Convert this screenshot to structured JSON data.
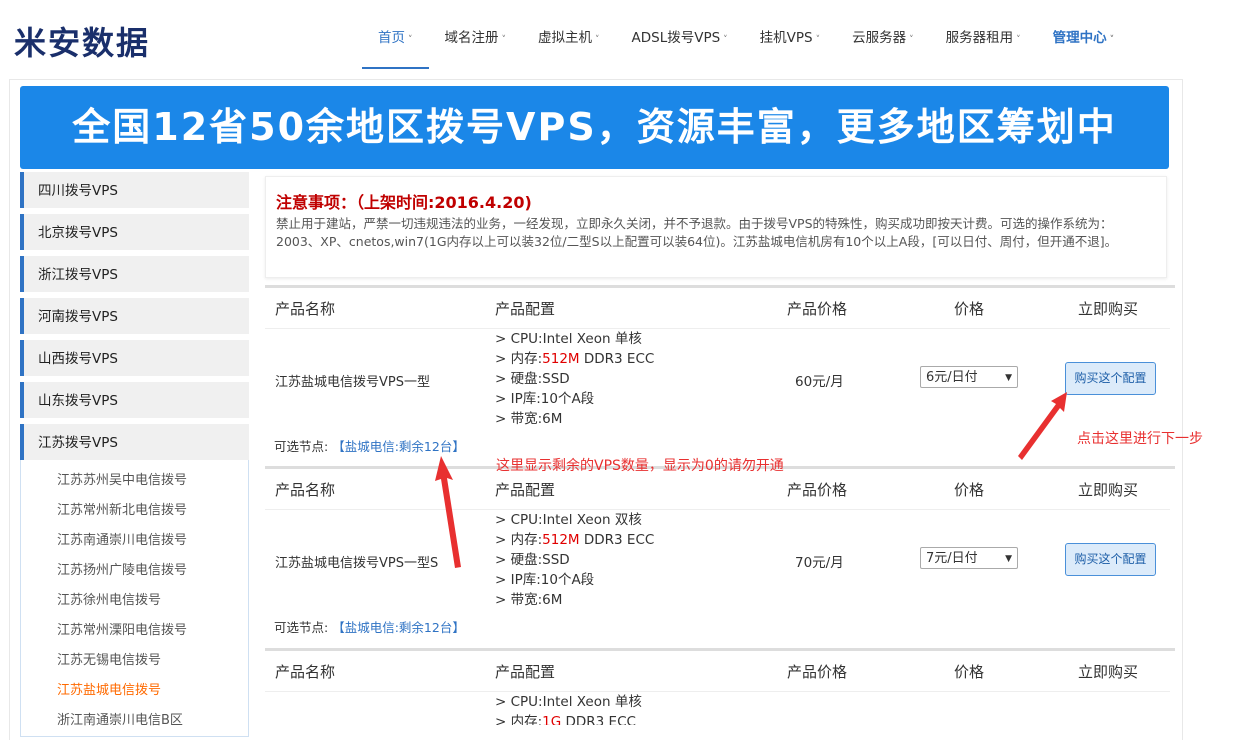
{
  "brand": {
    "logo": "米安数据"
  },
  "nav": [
    {
      "label": "首页",
      "chev": "˅"
    },
    {
      "label": "域名注册",
      "chev": "˅"
    },
    {
      "label": "虚拟主机",
      "chev": "˅"
    },
    {
      "label": "ADSL拨号VPS",
      "chev": "˅"
    },
    {
      "label": "挂机VPS",
      "chev": "˅"
    },
    {
      "label": "云服务器",
      "chev": "˅"
    },
    {
      "label": "服务器租用",
      "chev": "˅"
    },
    {
      "label": "管理中心",
      "chev": "˅"
    }
  ],
  "banner": {
    "text": "全国12省50余地区拨号VPS，资源丰富，更多地区筹划中"
  },
  "sidebar": {
    "items": [
      "四川拨号VPS",
      "北京拨号VPS",
      "浙江拨号VPS",
      "河南拨号VPS",
      "山西拨号VPS",
      "山东拨号VPS",
      "江苏拨号VPS"
    ],
    "sub_items": [
      "江苏苏州吴中电信拨号",
      "江苏常州新北电信拨号",
      "江苏南通崇川电信拨号",
      "江苏扬州广陵电信拨号",
      "江苏徐州电信拨号",
      "江苏常州溧阳电信拨号",
      "江苏无锡电信拨号",
      "江苏盐城电信拨号",
      "浙江南通崇川电信B区"
    ]
  },
  "notice": {
    "title": "注意事项：（上架时间:2016.4.20)",
    "body": "禁止用于建站，严禁一切违规违法的业务，一经发现，立即永久关闭，并不予退款。由于拨号VPS的特殊性，购买成功即按天计费。可选的操作系统为：2003、XP、cnetos,win7(1G内存以上可以装32位/二型S以上配置可以装64位)。江苏盐城电信机房有10个以上A段，[可以日付、周付，但开通不退]。"
  },
  "table_headers": {
    "name": "产品名称",
    "config": "产品配置",
    "product_price": "产品价格",
    "price": "价格",
    "buy": "立即购买"
  },
  "products": [
    {
      "name": "江苏盐城电信拨号VPS一型",
      "cpu": "> CPU:Intel Xeon 单核",
      "mem_prefix": "> 内存:",
      "mem_value": "512M",
      "mem_suffix": " DDR3 ECC",
      "disk": "> 硬盘:SSD",
      "ip": "> IP库:10个A段",
      "bw": "> 带宽:6M",
      "price": "60元/月",
      "select": "6元/日付",
      "buy": "购买这个配置",
      "node_label": "可选节点:",
      "node_link": "【盐城电信:剩余12台】"
    },
    {
      "name": "江苏盐城电信拨号VPS一型S",
      "cpu": "> CPU:Intel Xeon 双核",
      "mem_prefix": "> 内存:",
      "mem_value": "512M",
      "mem_suffix": " DDR3 ECC",
      "disk": "> 硬盘:SSD",
      "ip": "> IP库:10个A段",
      "bw": "> 带宽:6M",
      "price": "70元/月",
      "select": "7元/日付",
      "buy": "购买这个配置",
      "node_label": "可选节点:",
      "node_link": "【盐城电信:剩余12台】"
    },
    {
      "cpu": "> CPU:Intel Xeon 单核",
      "mem_prefix": "> 内存:",
      "mem_value": "1G",
      "mem_suffix": " DDR3 ECC"
    }
  ],
  "annotations": {
    "remaining": "这里显示剩余的VPS数量，显示为0的请勿开通",
    "next_step": "点击这里进行下一步"
  },
  "colors": {
    "accent": "#2f73c4",
    "banner": "#1b87e8",
    "annotation": "#e83030",
    "highlight": "#ff6a00"
  }
}
